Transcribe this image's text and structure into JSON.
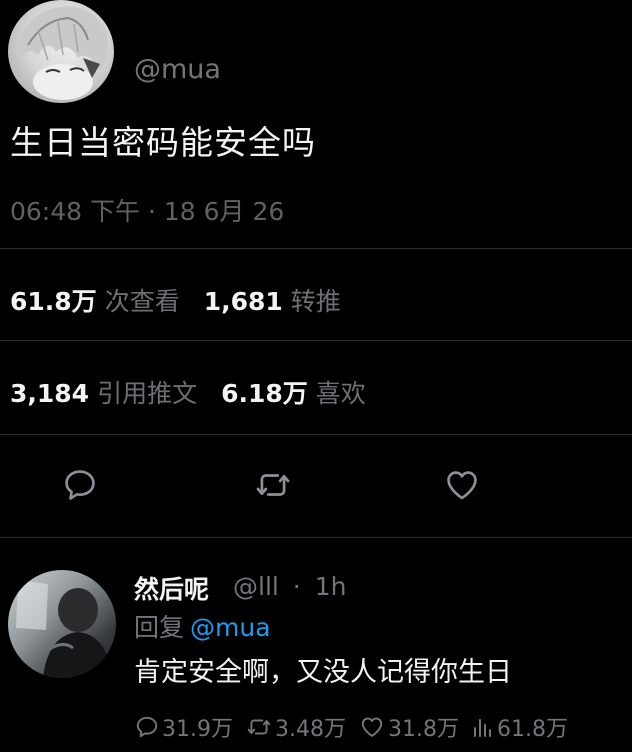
{
  "main_tweet": {
    "handle": "@mua",
    "text": "生日当密码能安全吗",
    "meta": "06:48 下午 · 18 6月 26",
    "stats": {
      "views_value": "61.8万",
      "views_label": "次查看",
      "retweets_value": "1,681",
      "retweets_label": "转推",
      "quotes_value": "3,184",
      "quotes_label": "引用推文",
      "likes_value": "6.18万",
      "likes_label": "喜欢"
    },
    "actions": {
      "reply_icon": "speech-bubble-icon",
      "retweet_icon": "retweet-icon",
      "like_icon": "heart-icon"
    }
  },
  "reply": {
    "name": "然后呢",
    "handle": "@lll",
    "dot": "·",
    "time": "1h",
    "replying_prefix": "回复",
    "replying_to": "@mua",
    "text": "肯定安全啊，又没人记得你生日",
    "actions": {
      "replies": "31.9万",
      "retweets": "3.48万",
      "likes": "31.8万",
      "views": "61.8万"
    }
  },
  "colors": {
    "background": "#000000",
    "text": "#e7e9ea",
    "muted": "#71767b",
    "link": "#1d9bf0",
    "divider": "#2b2d30"
  }
}
